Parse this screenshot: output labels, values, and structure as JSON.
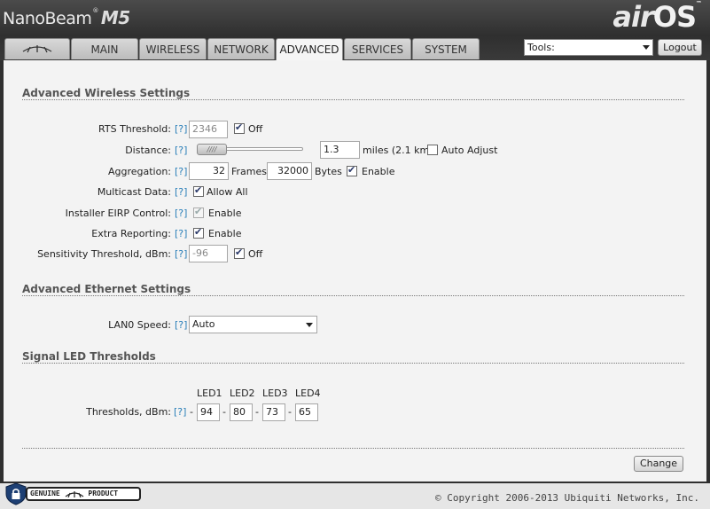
{
  "brand": {
    "name": "NanoBeam",
    "tm": "®",
    "model": "M5",
    "os_air": "air",
    "os": "OS",
    "os_tm": "™"
  },
  "tabs": [
    {
      "id": "logo",
      "label": ""
    },
    {
      "id": "main",
      "label": "MAIN"
    },
    {
      "id": "wireless",
      "label": "WIRELESS"
    },
    {
      "id": "network",
      "label": "NETWORK"
    },
    {
      "id": "advanced",
      "label": "ADVANCED",
      "active": true
    },
    {
      "id": "services",
      "label": "SERVICES"
    },
    {
      "id": "system",
      "label": "SYSTEM"
    }
  ],
  "toolbar": {
    "tools_value": "Tools:",
    "logout_label": "Logout"
  },
  "help": "[?]",
  "wireless": {
    "title": "Advanced Wireless Settings",
    "rts": {
      "label": "RTS Threshold:",
      "value": "2346",
      "off_label": "Off",
      "off_checked": true
    },
    "distance": {
      "label": "Distance:",
      "value": "1.3",
      "units": "miles (2.1 km)",
      "auto_label": "Auto Adjust",
      "auto_checked": false
    },
    "aggregation": {
      "label": "Aggregation:",
      "frames_value": "32",
      "frames_label": "Frames",
      "bytes_value": "32000",
      "bytes_label": "Bytes",
      "enable_label": "Enable",
      "enable_checked": true
    },
    "multicast": {
      "label": "Multicast Data:",
      "allow_label": "Allow All",
      "checked": true
    },
    "eirp": {
      "label": "Installer EIRP Control:",
      "enable_label": "Enable",
      "checked": true,
      "disabled": true
    },
    "extra": {
      "label": "Extra Reporting:",
      "enable_label": "Enable",
      "checked": true
    },
    "sensitivity": {
      "label": "Sensitivity Threshold, dBm:",
      "value": "-96",
      "off_label": "Off",
      "checked": true
    }
  },
  "ethernet": {
    "title": "Advanced Ethernet Settings",
    "lan0": {
      "label": "LAN0 Speed:",
      "value": "Auto"
    }
  },
  "led": {
    "title": "Signal LED Thresholds",
    "headers": [
      "LED1",
      "LED2",
      "LED3",
      "LED4"
    ],
    "label": "Thresholds, dBm:",
    "values": [
      "94",
      "80",
      "73",
      "65"
    ],
    "sep": "-"
  },
  "actions": {
    "change_label": "Change"
  },
  "footer": {
    "genuine": "GENUINE",
    "product": "PRODUCT",
    "copyright": "© Copyright 2006-2013 Ubiquiti Networks, Inc."
  }
}
